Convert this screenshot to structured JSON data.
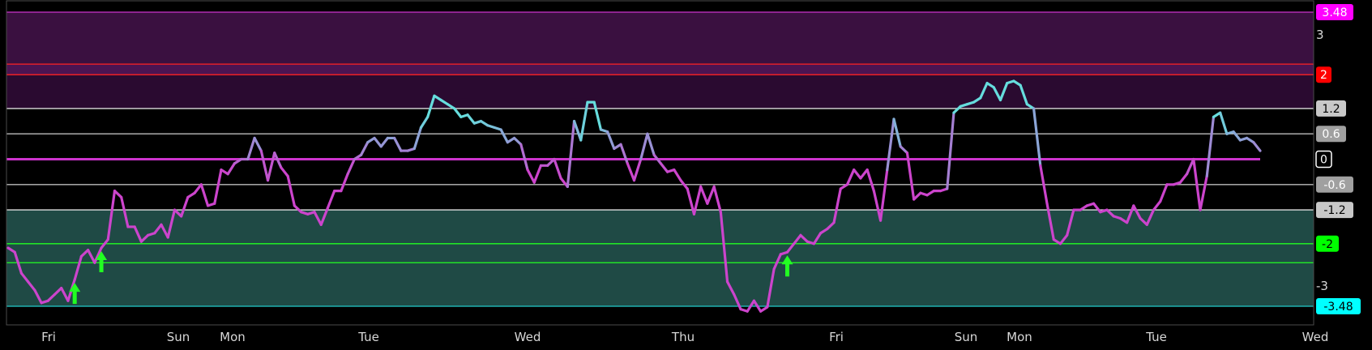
{
  "chart_data": {
    "type": "line",
    "x_labels": [
      "Fri",
      "Sun",
      "Mon",
      "Tue",
      "Wed",
      "Thu",
      "Fri",
      "Sun",
      "Mon",
      "Tue",
      "Wed"
    ],
    "ylim": [
      -3.48,
      3.48
    ],
    "y_ticks": [
      "3",
      "-3"
    ],
    "y_badges": [
      {
        "label": "3.48",
        "value": 3.48,
        "bg": "#ff00ff",
        "fg": "#ffffff"
      },
      {
        "label": "2",
        "value": 2,
        "bg": "#ff0000",
        "fg": "#ffffff"
      },
      {
        "label": "1.2",
        "value": 1.2,
        "bg": "#c8c8c8",
        "fg": "#000000"
      },
      {
        "label": "0.6",
        "value": 0.6,
        "bg": "#a0a0a0",
        "fg": "#ffffff"
      },
      {
        "label": "0",
        "value": 0,
        "bg": "#000000",
        "fg": "#ffffff",
        "border": "#ffffff"
      },
      {
        "label": "-0.6",
        "value": -0.6,
        "bg": "#a0a0a0",
        "fg": "#ffffff"
      },
      {
        "label": "-1.2",
        "value": -1.2,
        "bg": "#c8c8c8",
        "fg": "#000000"
      },
      {
        "label": "-2",
        "value": -2,
        "bg": "#00ff00",
        "fg": "#000000"
      },
      {
        "label": "-3.48",
        "value": -3.48,
        "bg": "#00ffff",
        "fg": "#000000"
      }
    ],
    "zones": [
      {
        "from": 2.25,
        "to": 3.48,
        "color": "#3a1040"
      },
      {
        "from": 1.2,
        "to": 2.25,
        "color": "#2a0a30"
      },
      {
        "from": 2,
        "to": 2.25,
        "color": "#4a1452"
      },
      {
        "from": -3.48,
        "to": -1.2,
        "color": "#1f4a45"
      }
    ],
    "levels": [
      {
        "value": 3.48,
        "color": "#cc33cc"
      },
      {
        "value": 2.25,
        "color": "#ff2222"
      },
      {
        "value": 2,
        "color": "#ff2222"
      },
      {
        "value": 1.2,
        "color": "#dddddd"
      },
      {
        "value": 0.6,
        "color": "#bbbbbb"
      },
      {
        "value": -0.6,
        "color": "#bbbbbb"
      },
      {
        "value": -1.2,
        "color": "#dddddd"
      },
      {
        "value": -2,
        "color": "#22ff22"
      },
      {
        "value": -2.45,
        "color": "#22ff22"
      },
      {
        "value": -3.48,
        "color": "#22cccc"
      }
    ],
    "zero_line": {
      "value": 0
    },
    "series": [
      {
        "color_low": "#cc44cc",
        "color_high": "#66dddd",
        "values": [
          -2.1,
          -2.2,
          -2.7,
          -2.9,
          -3.1,
          -3.4,
          -3.35,
          -3.2,
          -3.05,
          -3.35,
          -2.85,
          -2.3,
          -2.15,
          -2.45,
          -2.1,
          -1.9,
          -0.75,
          -0.9,
          -1.6,
          -1.6,
          -1.95,
          -1.8,
          -1.75,
          -1.55,
          -1.85,
          -1.2,
          -1.35,
          -0.9,
          -0.8,
          -0.6,
          -1.1,
          -1.05,
          -0.25,
          -0.35,
          -0.1,
          0.0,
          0.0,
          0.5,
          0.2,
          -0.5,
          0.15,
          -0.2,
          -0.4,
          -1.1,
          -1.25,
          -1.3,
          -1.25,
          -1.55,
          -1.15,
          -0.75,
          -0.75,
          -0.35,
          0.0,
          0.1,
          0.4,
          0.5,
          0.3,
          0.5,
          0.5,
          0.2,
          0.2,
          0.25,
          0.75,
          1.0,
          1.5,
          1.4,
          1.3,
          1.2,
          1.0,
          1.05,
          0.85,
          0.9,
          0.8,
          0.75,
          0.7,
          0.4,
          0.5,
          0.35,
          -0.25,
          -0.55,
          -0.15,
          -0.15,
          0.0,
          -0.45,
          -0.65,
          0.9,
          0.45,
          1.35,
          1.35,
          0.7,
          0.65,
          0.25,
          0.35,
          -0.1,
          -0.5,
          0.0,
          0.6,
          0.1,
          -0.1,
          -0.3,
          -0.25,
          -0.5,
          -0.7,
          -1.3,
          -0.65,
          -1.05,
          -0.65,
          -1.25,
          -2.9,
          -3.2,
          -3.55,
          -3.6,
          -3.35,
          -3.6,
          -3.5,
          -2.6,
          -2.25,
          -2.2,
          -2.0,
          -1.8,
          -1.95,
          -2.0,
          -1.75,
          -1.65,
          -1.5,
          -0.7,
          -0.6,
          -0.25,
          -0.45,
          -0.25,
          -0.75,
          -1.45,
          -0.25,
          0.95,
          0.3,
          0.15,
          -0.95,
          -0.8,
          -0.85,
          -0.75,
          -0.75,
          -0.7,
          1.1,
          1.25,
          1.3,
          1.35,
          1.45,
          1.8,
          1.7,
          1.4,
          1.8,
          1.85,
          1.75,
          1.3,
          1.2,
          -0.15,
          -1.05,
          -1.9,
          -2.0,
          -1.8,
          -1.2,
          -1.2,
          -1.1,
          -1.05,
          -1.25,
          -1.2,
          -1.35,
          -1.4,
          -1.5,
          -1.1,
          -1.4,
          -1.55,
          -1.2,
          -1.0,
          -0.6,
          -0.6,
          -0.55,
          -0.35,
          0.0,
          -1.2,
          -0.4,
          1.0,
          1.1,
          0.6,
          0.65,
          0.45,
          0.5,
          0.4,
          0.2
        ]
      }
    ],
    "arrows": [
      {
        "index": 10,
        "color": "#22ff22"
      },
      {
        "index": 14,
        "color": "#22ff22"
      },
      {
        "index": 117,
        "color": "#22ff22"
      }
    ]
  }
}
